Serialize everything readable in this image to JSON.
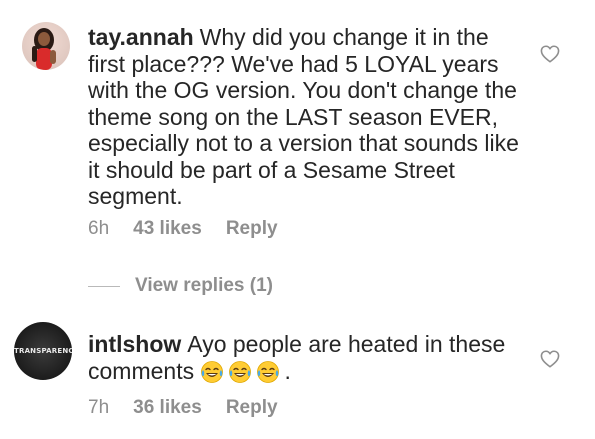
{
  "comments": [
    {
      "username": "tay.annah",
      "text": "Why did you change it in the first place??? We've had 5 LOYAL years with the OG version. You don't change the theme song on the LAST season EVER, especially not to a version that sounds like it should be part of a Sesame Street segment.",
      "time": "6h",
      "likes": "43 likes",
      "reply": "Reply",
      "view_replies": "View replies (1)",
      "like_icon": "heart-outline-icon"
    },
    {
      "username": "intlshow",
      "avatar_text": "TRANSPARENCY",
      "text": "Ayo people are heated in these comments",
      "emojis": [
        "face-with-tears-of-joy",
        "face-with-tears-of-joy",
        "face-with-tears-of-joy"
      ],
      "text_suffix": ".",
      "time": "7h",
      "likes": "36 likes",
      "reply": "Reply",
      "like_icon": "heart-outline-icon"
    }
  ],
  "colors": {
    "text": "#262626",
    "meta": "#8e8e8e",
    "divider": "#b9b9b9",
    "emoji_face": "#ffcc33",
    "emoji_tears": "#47a9e9"
  }
}
